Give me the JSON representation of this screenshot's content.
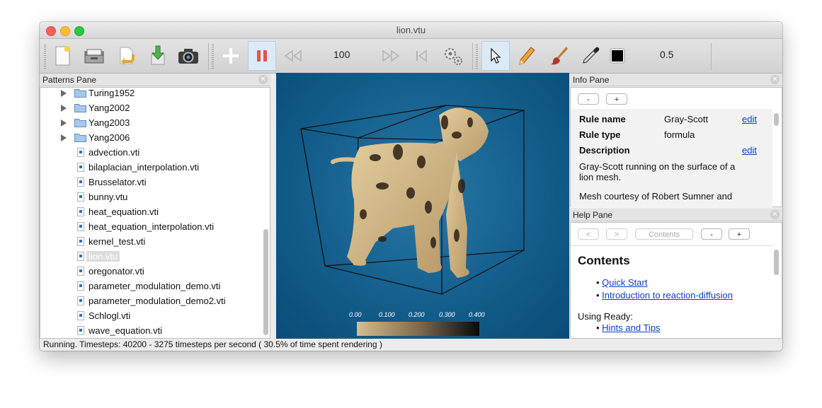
{
  "window": {
    "title": "lion.vtu"
  },
  "toolbar": {
    "speed_value": "100",
    "brush_size_value": "0.5"
  },
  "patterns_pane": {
    "title": "Patterns Pane",
    "folders": [
      "Turing1952",
      "Yang2002",
      "Yang2003",
      "Yang2006"
    ],
    "files": [
      "advection.vti",
      "bilaplacian_interpolation.vti",
      "Brusselator.vti",
      "bunny.vtu",
      "heat_equation.vti",
      "heat_equation_interpolation.vti",
      "kernel_test.vti",
      "lion.vtu",
      "oregonator.vti",
      "parameter_modulation_demo.vti",
      "parameter_modulation_demo2.vti",
      "Schlogl.vti",
      "wave_equation.vti"
    ],
    "selected": "lion.vtu"
  },
  "viewport": {
    "colorbar_labels": [
      "0.00",
      "0.100",
      "0.200",
      "0.300",
      "0.400"
    ]
  },
  "info_pane": {
    "title": "Info Pane",
    "minus_label": "-",
    "plus_label": "+",
    "rule_name_key": "Rule name",
    "rule_name_value": "Gray-Scott",
    "rule_type_key": "Rule type",
    "rule_type_value": "formula",
    "description_key": "Description",
    "edit_label": "edit",
    "description_line1": "Gray-Scott running on the surface of a",
    "description_line2": "lion mesh.",
    "description_line3": "Mesh courtesy of Robert Sumner and"
  },
  "help_pane": {
    "title": "Help Pane",
    "back_label": "<",
    "forward_label": ">",
    "contents_label": "Contents",
    "minus_label": "-",
    "plus_label": "+",
    "heading": "Contents",
    "link1": "Quick Start",
    "link2": "Introduction to reaction-diffusion",
    "using_label": "Using Ready:",
    "link3": "Hints and Tips"
  },
  "status": {
    "text": "Running. Timesteps: 40200  -  3275 timesteps per second   ( 30.5% of time spent rendering )"
  }
}
